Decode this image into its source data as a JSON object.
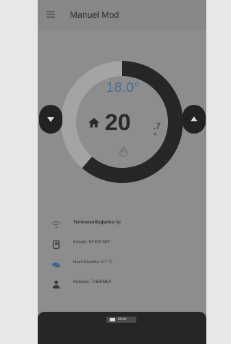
{
  "app": {
    "title": "Manuel Mod"
  },
  "thermostat": {
    "target_temp": "18.0°",
    "current_temp_int": "20",
    "current_temp_dec": ".7 °"
  },
  "info": [
    {
      "icon": "wifi-icon",
      "text": "Termostatı Bağlantısı İyi",
      "bold": true
    },
    {
      "icon": "device-icon",
      "text": "Konum: HT300 SET",
      "bold": false
    },
    {
      "icon": "weather-icon",
      "text": "Hava Durumu: 9.7 °C",
      "bold": false
    },
    {
      "icon": "user-icon",
      "text": "Kullanıcı: THERMEX",
      "bold": false
    }
  ],
  "bottom": {
    "button_label": "Mode"
  },
  "colors": {
    "screen_bg": "#8d8d8d",
    "dial_arc_active": "#262626",
    "dial_arc_inactive": "#a8a8a8",
    "target_temp": "#4a6c93"
  }
}
